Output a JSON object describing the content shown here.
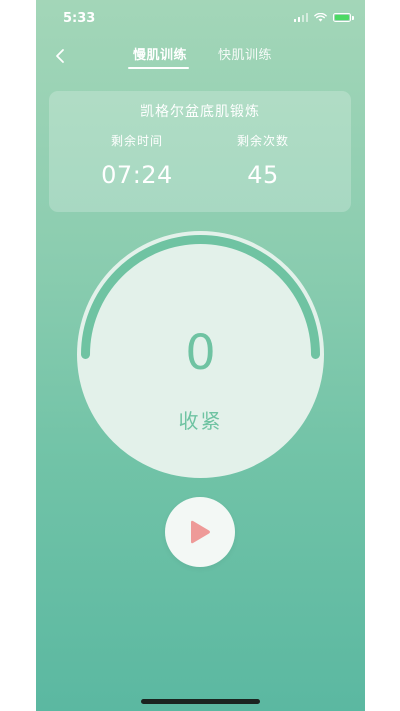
{
  "status_bar": {
    "time": "5:33",
    "icons": [
      "cellular-signal-icon",
      "wifi-icon",
      "battery-charging-icon"
    ]
  },
  "nav": {
    "back_icon": "chevron-left-icon",
    "tabs": [
      {
        "label": "慢肌训练",
        "active": true
      },
      {
        "label": "快肌训练",
        "active": false
      }
    ]
  },
  "info_card": {
    "title": "凯格尔盆底肌锻炼",
    "remaining_time_label": "剩余时间",
    "remaining_time_value": "07:24",
    "remaining_count_label": "剩余次数",
    "remaining_count_value": "45"
  },
  "dial": {
    "count": "0",
    "phase": "收紧"
  },
  "controls": {
    "play_icon": "play-icon"
  },
  "colors": {
    "accent": "#6fc3a2",
    "play": "#ee9a98",
    "gradient_top": "#a3d6b8",
    "gradient_bottom": "#5bb8a1"
  }
}
